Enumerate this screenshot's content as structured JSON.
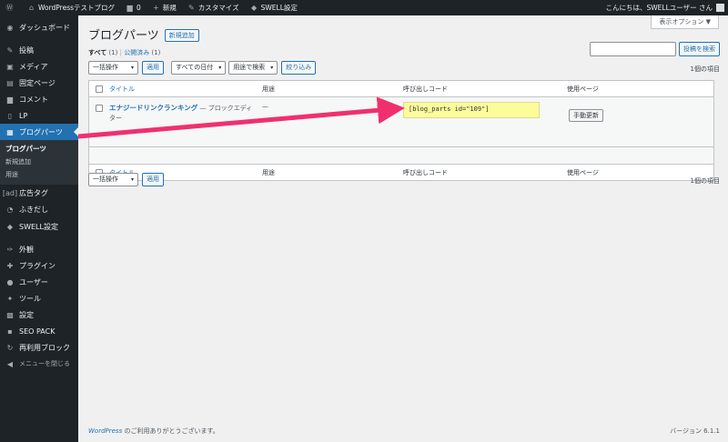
{
  "adminbar": {
    "site": "WordPressテストブログ",
    "comments_count": "0",
    "new": "新規",
    "customize": "カスタマイズ",
    "swell": "SWELL設定",
    "greeting": "こんにちは、SWELLユーザー さん"
  },
  "sidebar": {
    "items": [
      {
        "icon": "dashboard-icon",
        "glyph": "◉",
        "label": "ダッシュボード"
      },
      {
        "icon": "pin-icon",
        "glyph": "✎",
        "label": "投稿"
      },
      {
        "icon": "media-icon",
        "glyph": "▣",
        "label": "メディア"
      },
      {
        "icon": "page-icon",
        "glyph": "▤",
        "label": "固定ページ"
      },
      {
        "icon": "comment-icon",
        "glyph": "▆",
        "label": "コメント"
      },
      {
        "icon": "lp-icon",
        "glyph": "▯",
        "label": "LP"
      },
      {
        "icon": "blog-parts-icon",
        "glyph": "▦",
        "label": "ブログパーツ"
      },
      {
        "icon": "ad-tag-icon",
        "glyph": "[ad]",
        "label": "広告タグ"
      },
      {
        "icon": "balloon-icon",
        "glyph": "◔",
        "label": "ふきだし"
      },
      {
        "icon": "swell-icon",
        "glyph": "◆",
        "label": "SWELL設定"
      },
      {
        "icon": "appearance-icon",
        "glyph": "✑",
        "label": "外観"
      },
      {
        "icon": "plugin-icon",
        "glyph": "✚",
        "label": "プラグイン"
      },
      {
        "icon": "user-icon",
        "glyph": "●",
        "label": "ユーザー"
      },
      {
        "icon": "tool-icon",
        "glyph": "✦",
        "label": "ツール"
      },
      {
        "icon": "settings-icon",
        "glyph": "▩",
        "label": "設定"
      },
      {
        "icon": "seo-pack-icon",
        "glyph": "▪",
        "label": "SEO PACK"
      },
      {
        "icon": "reusable-block-icon",
        "glyph": "↻",
        "label": "再利用ブロック"
      },
      {
        "icon": "collapse-icon",
        "glyph": "◀",
        "label": "メニューを閉じる"
      }
    ],
    "submenu": [
      "ブログパーツ",
      "新規追加",
      "用途"
    ]
  },
  "header": {
    "title": "ブログパーツ",
    "add_new": "新規追加",
    "screen_options": "表示オプション ▼"
  },
  "filters": {
    "all": "すべて",
    "all_count": "(1)",
    "published": "公開済み",
    "published_count": "(1)",
    "bulk_action": "一括操作",
    "apply": "適用",
    "all_dates": "すべての日付",
    "by_use": "用途で検索",
    "filter": "絞り込み",
    "search_button": "投稿を検索",
    "count": "1個の項目"
  },
  "table": {
    "col_title": "タイトル",
    "col_use": "用途",
    "col_shortcode": "呼び出しコード",
    "col_pages": "使用ページ",
    "row_title": "エナジードリンクランキング",
    "row_state": "— ブロックエディター",
    "row_use": "—",
    "row_shortcode": "[blog_parts id=\"109\"]",
    "row_button": "手動更新"
  },
  "footer": {
    "wp_link": "WordPress",
    "thanks": "のご利用ありがとうございます。",
    "version": "バージョン 6.1.1"
  },
  "annotation_color": "#f0306e"
}
